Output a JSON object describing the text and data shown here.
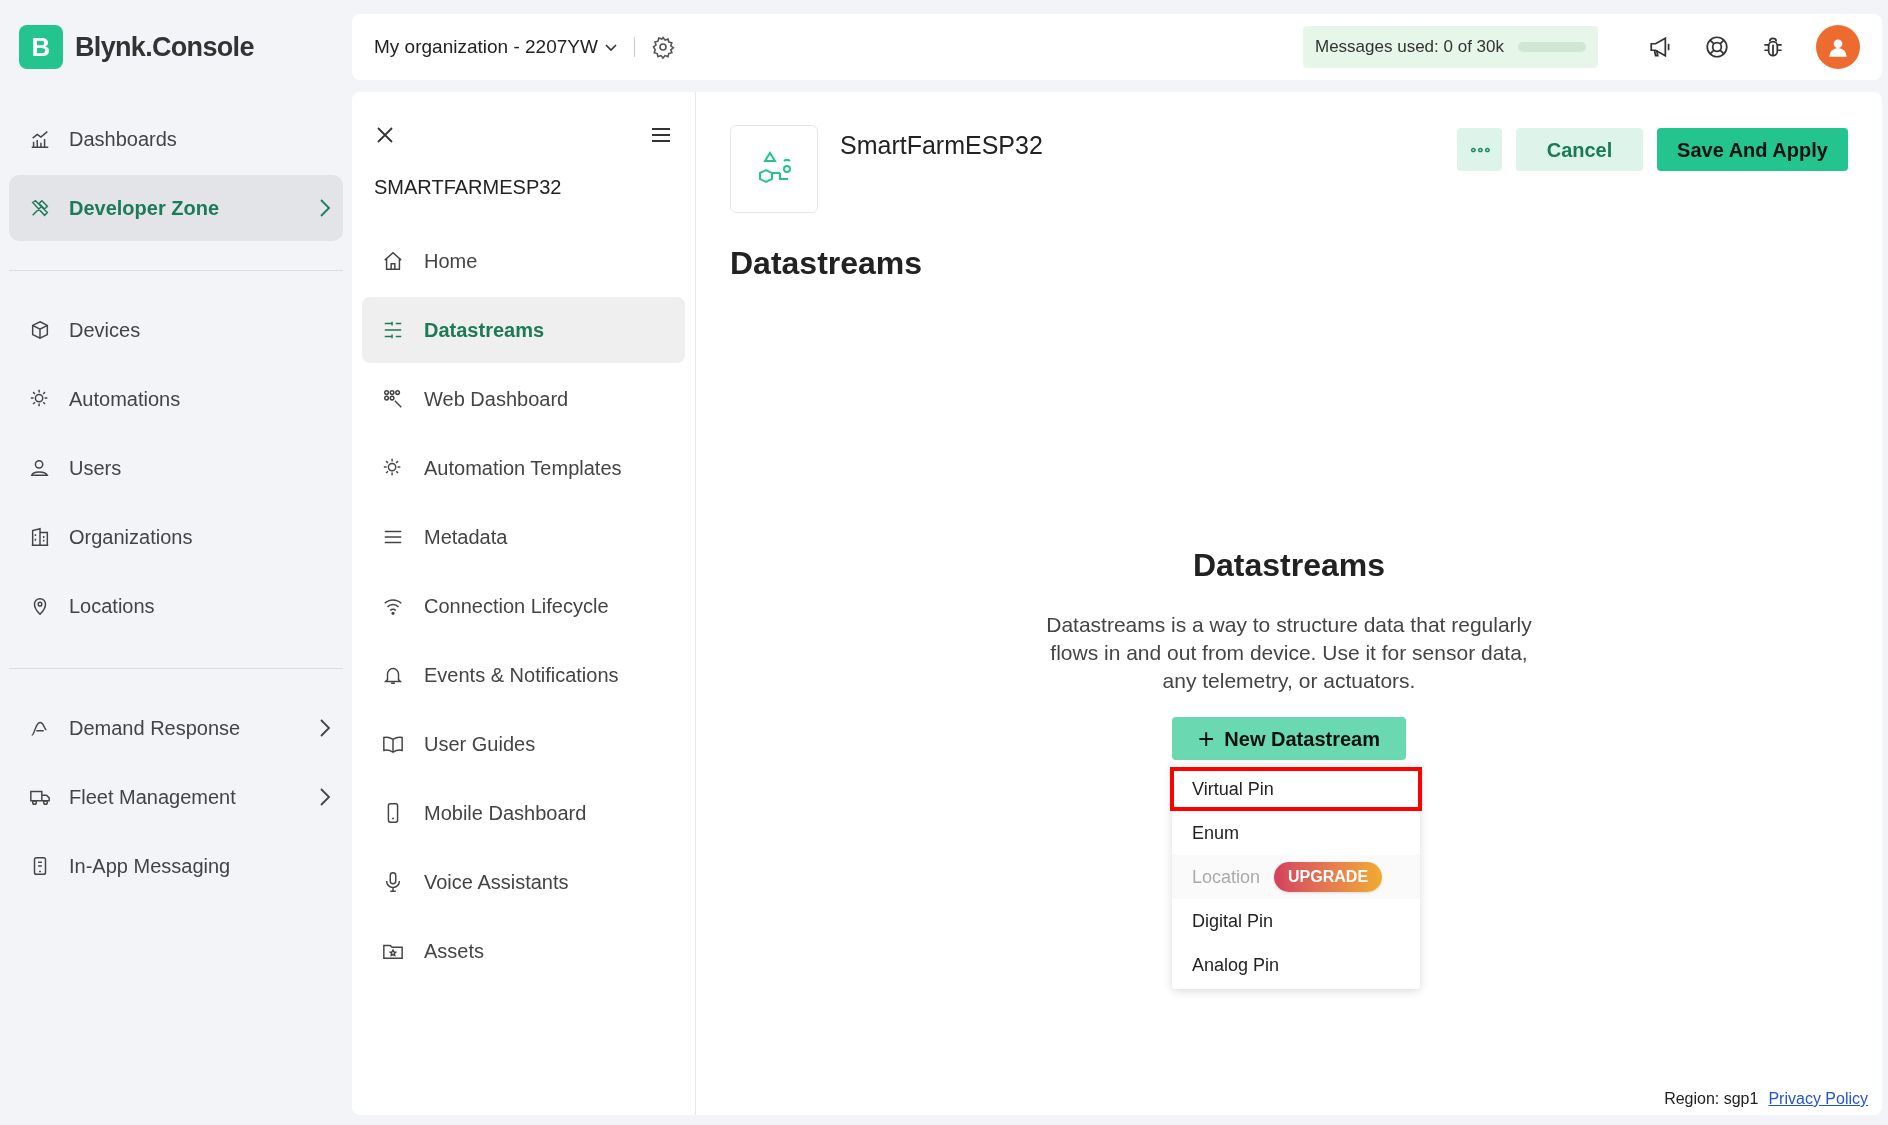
{
  "brand": {
    "logo_letter": "B",
    "name": "Blynk.Console"
  },
  "topbar": {
    "organization": "My organization - 2207YW",
    "messages_label": "Messages used:",
    "messages_value": "0 of 30k",
    "usage_bar": {
      "level": 0.0
    }
  },
  "sidebar": {
    "sections": [
      [
        {
          "label": "Dashboards",
          "selected": false,
          "expandable": false
        },
        {
          "label": "Developer Zone",
          "selected": true,
          "expandable": true
        }
      ],
      [
        {
          "label": "Devices",
          "selected": false,
          "expandable": false
        },
        {
          "label": "Automations",
          "selected": false,
          "expandable": false
        },
        {
          "label": "Users",
          "selected": false,
          "expandable": false
        },
        {
          "label": "Organizations",
          "selected": false,
          "expandable": false
        },
        {
          "label": "Locations",
          "selected": false,
          "expandable": false
        }
      ],
      [
        {
          "label": "Demand Response",
          "selected": false,
          "expandable": true
        },
        {
          "label": "Fleet Management",
          "selected": false,
          "expandable": true
        },
        {
          "label": "In-App Messaging",
          "selected": false,
          "expandable": false
        }
      ]
    ]
  },
  "template_nav": {
    "title": "SMARTFARMESP32",
    "items": [
      {
        "label": "Home",
        "selected": false
      },
      {
        "label": "Datastreams",
        "selected": true
      },
      {
        "label": "Web Dashboard",
        "selected": false
      },
      {
        "label": "Automation Templates",
        "selected": false
      },
      {
        "label": "Metadata",
        "selected": false
      },
      {
        "label": "Connection Lifecycle",
        "selected": false
      },
      {
        "label": "Events & Notifications",
        "selected": false
      },
      {
        "label": "User Guides",
        "selected": false
      },
      {
        "label": "Mobile Dashboard",
        "selected": false
      },
      {
        "label": "Voice Assistants",
        "selected": false
      },
      {
        "label": "Assets",
        "selected": false
      }
    ]
  },
  "header": {
    "template_name": "SmartFarmESP32",
    "more_button": "∘∘∘",
    "cancel_button": "Cancel",
    "save_button": "Save And Apply"
  },
  "page_title": "Datastreams",
  "empty_state": {
    "heading": "Datastreams",
    "description": "Datastreams is a way to structure data that regularly flows in and out from device. Use it for sensor data, any telemetry, or actuators.",
    "button_icon": "+",
    "button": "New Datastream",
    "menu": [
      {
        "label": "Virtual Pin",
        "disabled": false,
        "highlighted": true
      },
      {
        "label": "Enum",
        "disabled": false,
        "highlighted": false
      },
      {
        "label": "Location",
        "disabled": true,
        "highlighted": false,
        "badge": "UPGRADE"
      },
      {
        "label": "Digital Pin",
        "disabled": false,
        "highlighted": false
      },
      {
        "label": "Analog Pin",
        "disabled": false,
        "highlighted": false
      }
    ]
  },
  "footer": {
    "region": "Region: sgp1",
    "privacy_link": "Privacy Policy"
  }
}
